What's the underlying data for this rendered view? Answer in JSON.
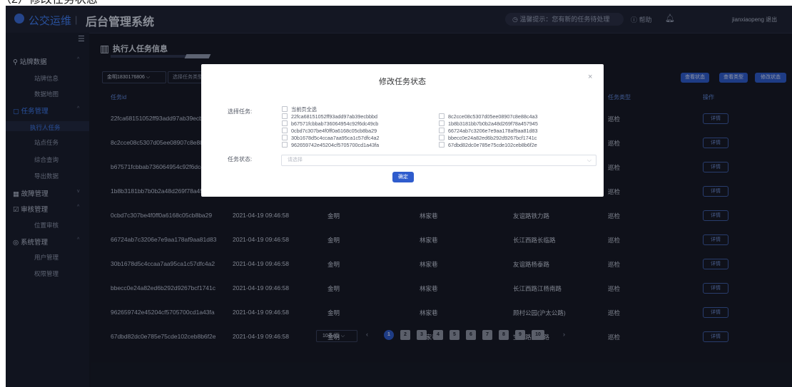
{
  "caption": "（2）修改任务状态",
  "header": {
    "brand": "公交运维",
    "separator": "|",
    "system_title": "后台管理系统",
    "notice": "温馨提示：您有新的任务待处理",
    "help": "帮助",
    "user": "jianxiaopeng  退出"
  },
  "sidebar": {
    "groups": [
      {
        "label": "站牌数据",
        "items": [
          "站牌信息",
          "数据地图"
        ]
      },
      {
        "label": "任务管理",
        "items": [
          "执行人任务",
          "站点任务",
          "综合查询",
          "导出数据"
        ]
      },
      {
        "label": "故障管理",
        "items": []
      },
      {
        "label": "审核管理",
        "items": [
          "位置审核"
        ]
      },
      {
        "label": "系统管理",
        "items": [
          "用户管理",
          "权限管理"
        ]
      }
    ]
  },
  "main": {
    "page_title": "执行人任务信息",
    "filter_user": "金明1830176806",
    "filter_task": "选择任务类型",
    "buttons": [
      "查看状态",
      "查看类型",
      "修改状态"
    ],
    "columns": {
      "id": "任务id",
      "type": "任务类型",
      "action": "操作"
    },
    "rows": [
      {
        "id": "22fca68151052ff93add97ab39ecbbbd",
        "time": "",
        "name": "",
        "line": "",
        "stop": "",
        "type": "巡检"
      },
      {
        "id": "8c2cce08c5307d05ee08907c8e88c4a3",
        "time": "",
        "name": "",
        "line": "",
        "stop": "",
        "type": "巡检"
      },
      {
        "id": "b67571fcbbab736064954c92f6dc49cb",
        "time": "",
        "name": "",
        "line": "",
        "stop": "",
        "type": "巡检"
      },
      {
        "id": "1b8b3181bb7b0b2a48d269f78a457945",
        "time": "",
        "name": "",
        "line": "",
        "stop": "",
        "type": "巡检"
      },
      {
        "id": "0cbd7c307be4f0ff0a6168c05cb8ba29",
        "time": "2021-04-19 09:46:58",
        "name": "金明",
        "line": "林家巷",
        "stop": "友谊路铁力路",
        "type": "巡检"
      },
      {
        "id": "66724ab7c3206e7e9aa178af9aa81d83",
        "time": "2021-04-19 09:46:58",
        "name": "金明",
        "line": "林家巷",
        "stop": "长江西路长临路",
        "type": "巡检"
      },
      {
        "id": "30b1678d5c4ccaa7aa95ca1c57dfc4a2",
        "time": "2021-04-19 09:46:58",
        "name": "金明",
        "line": "林家巷",
        "stop": "友谊路杨泰路",
        "type": "巡检"
      },
      {
        "id": "bbecc0e24a82ed6b292d9267bcf1741c",
        "time": "2021-04-19 09:46:58",
        "name": "金明",
        "line": "林家巷",
        "stop": "长江西路江杨南路",
        "type": "巡检"
      },
      {
        "id": "962659742e45204cf5705700cd1a43fa",
        "time": "2021-04-19 09:46:58",
        "name": "金明",
        "line": "林家巷",
        "stop": "顾村公园(沪太公路)",
        "type": "巡检"
      },
      {
        "id": "67dbd82dc0e785e75cde102ceb8b6f2e",
        "time": "2021-04-19 09:46:58",
        "name": "金明",
        "line": "林家巷",
        "stop": "宝杨路宝东路",
        "type": "巡检"
      }
    ],
    "detail_label": "详情",
    "pager": {
      "page_size": "10条/页",
      "prev": "‹",
      "next": "›",
      "pages": [
        "1",
        "2",
        "3",
        "4",
        "5",
        "6",
        "7",
        "8",
        "9",
        "10"
      ],
      "current": "1"
    }
  },
  "modal": {
    "title": "修改任务状态",
    "close": "×",
    "task_label": "选择任务:",
    "select_all": "当前页全选",
    "tasks_left": [
      "22fca68151052ff93add97ab39ecbbbd",
      "b67571fcbbab736064954c92f6dc49cb",
      "0cbd7c307be4f0ff0a6168c05cb8ba29",
      "30b1678d5c4ccaa7aa95ca1c57dfc4a2",
      "962659742e45204cf5705700cd1a43fa"
    ],
    "tasks_right": [
      "8c2cce08c5307d05ee08907c8e88c4a3",
      "1b8b3181bb7b0b2a48d269f78a457945",
      "66724ab7c3206e7e9aa178af9aa81d83",
      "bbecc0e24a82ed6b292d9267bcf1741c",
      "67dbd82dc0e785e75cde102ceb8b6f2e"
    ],
    "status_label": "任务状态:",
    "status_placeholder": "请选择",
    "confirm": "确定"
  },
  "colors": {
    "accent": "#2f5ccd",
    "bg": "#171b29",
    "link": "#3f7cf0"
  }
}
